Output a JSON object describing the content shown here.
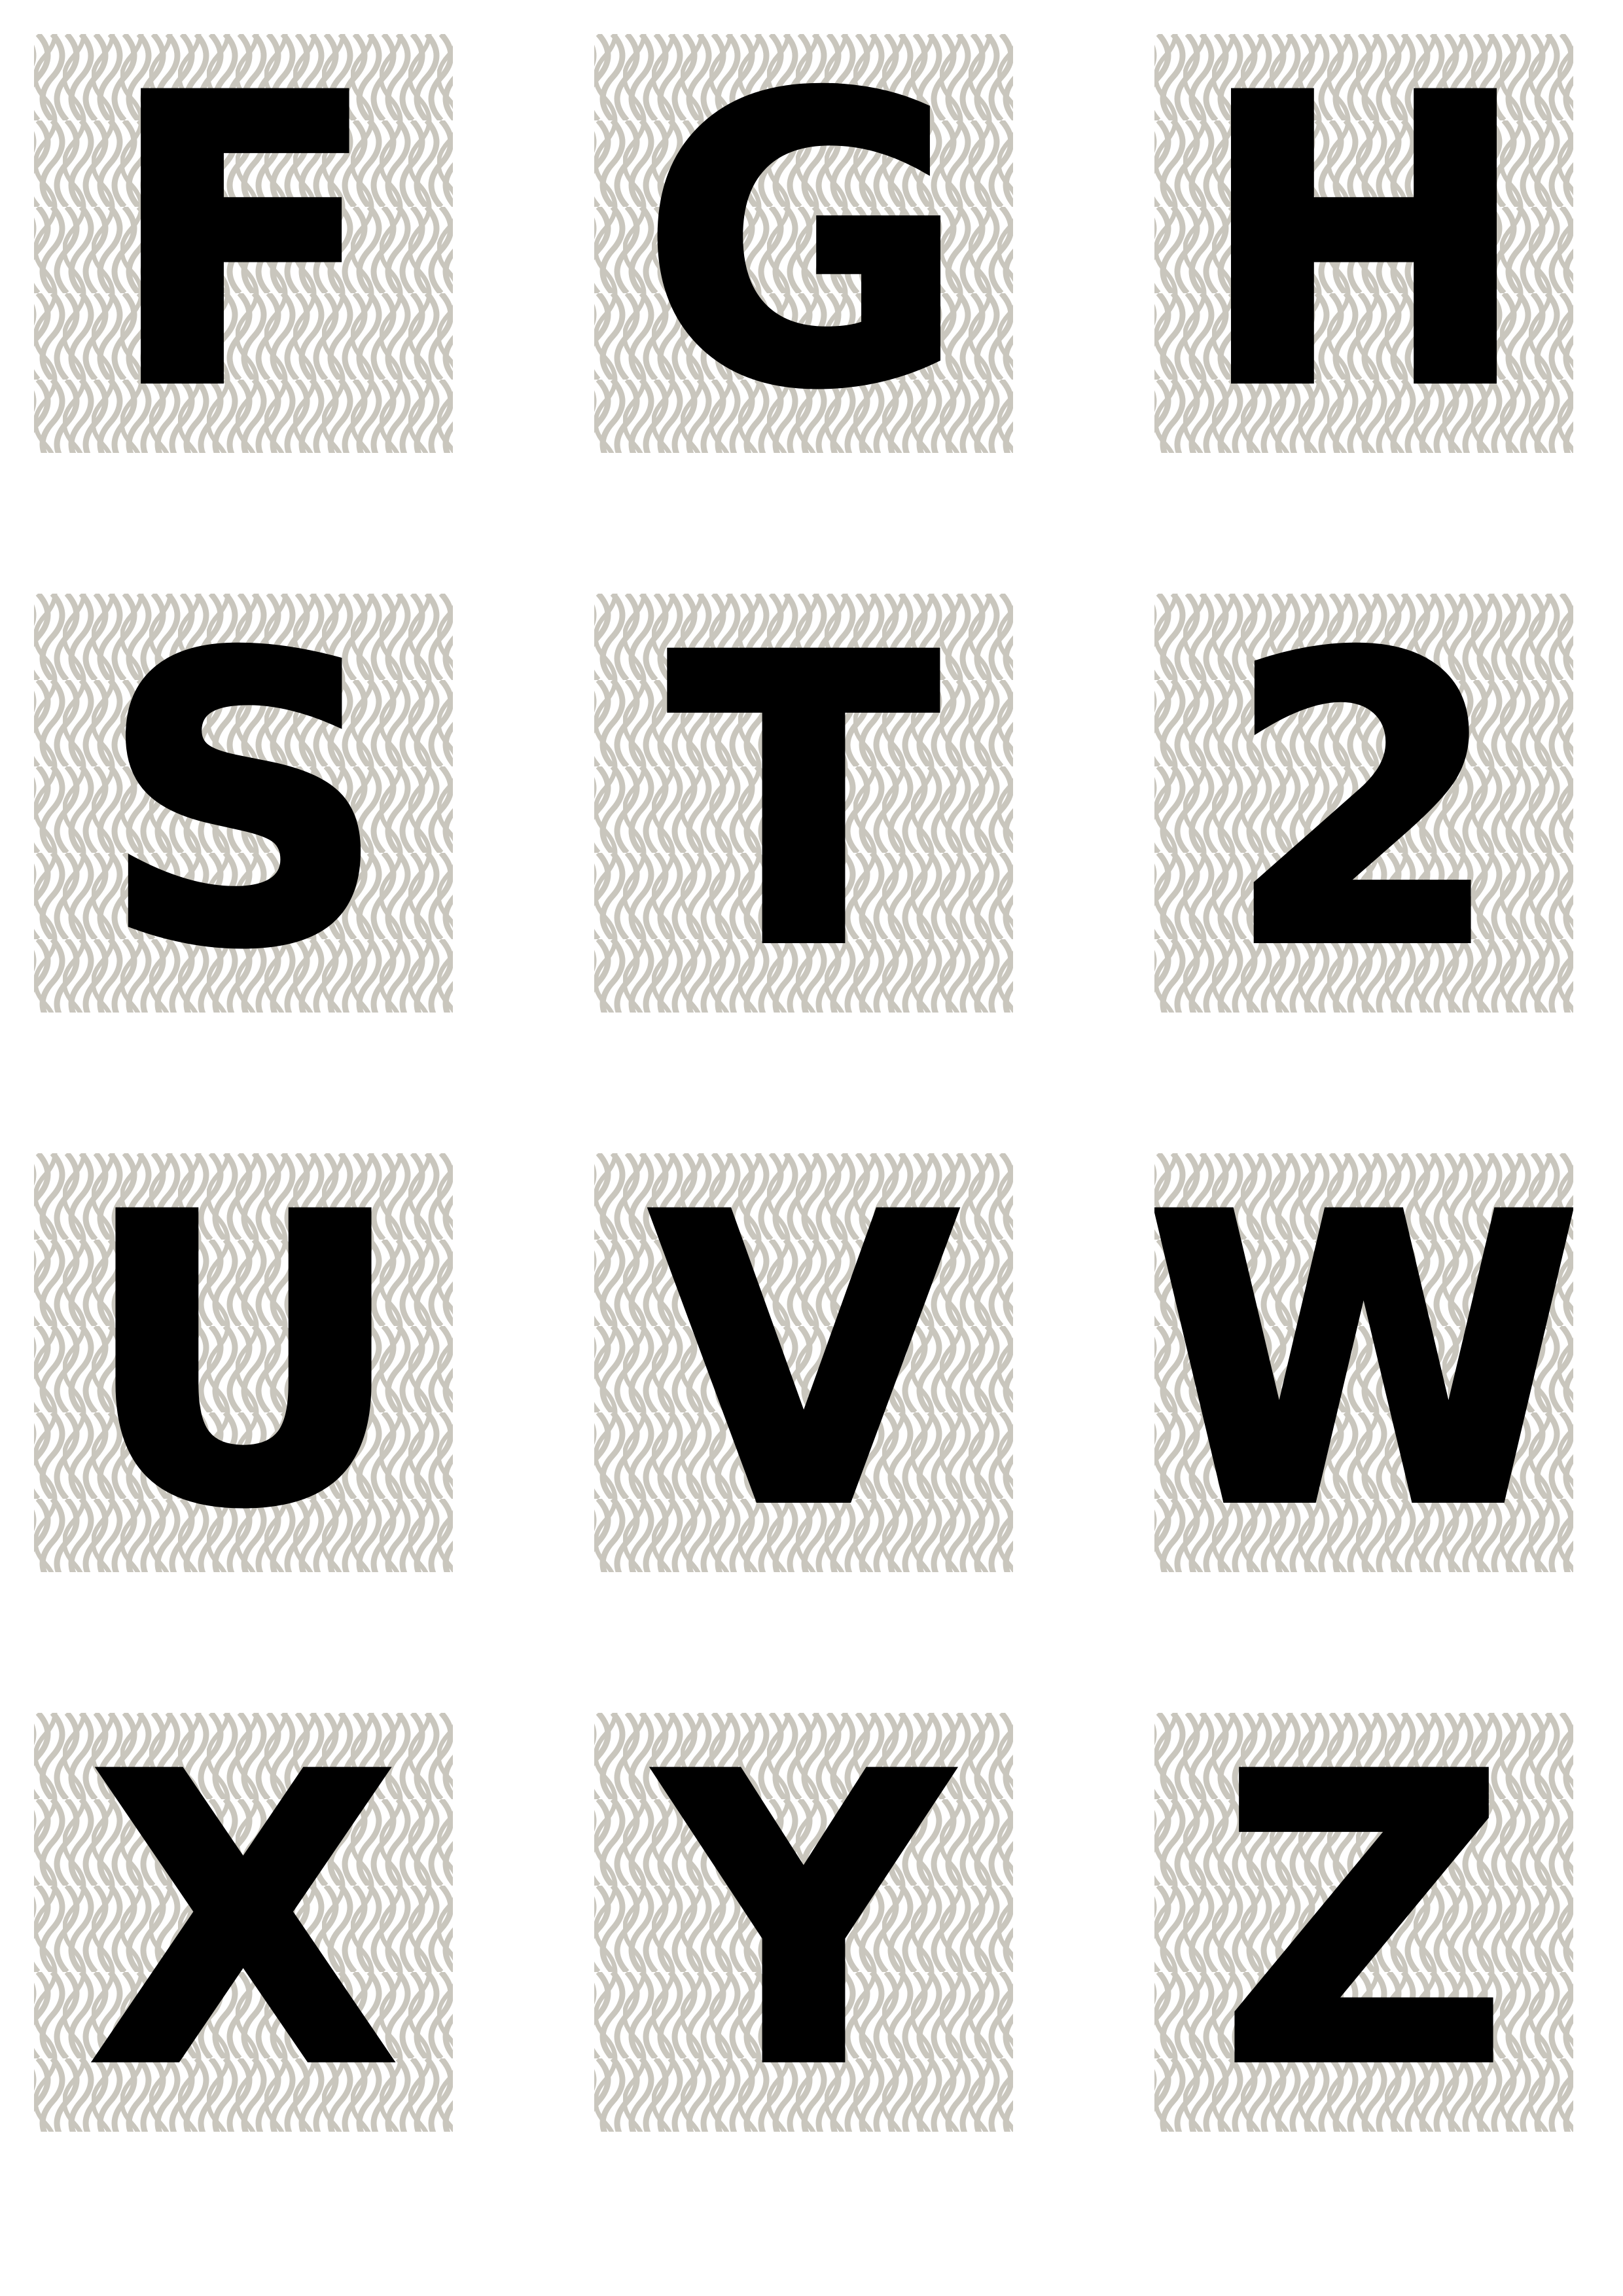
{
  "colors": {
    "pattern_stroke": "#c9c6bd",
    "background": "#ffffff",
    "letter": "#000000"
  },
  "cards": [
    {
      "letter": "F"
    },
    {
      "letter": "G"
    },
    {
      "letter": "H"
    },
    {
      "letter": "S"
    },
    {
      "letter": "T"
    },
    {
      "letter": "2"
    },
    {
      "letter": "U"
    },
    {
      "letter": "V"
    },
    {
      "letter": "W"
    },
    {
      "letter": "X"
    },
    {
      "letter": "Y"
    },
    {
      "letter": "Z"
    }
  ]
}
